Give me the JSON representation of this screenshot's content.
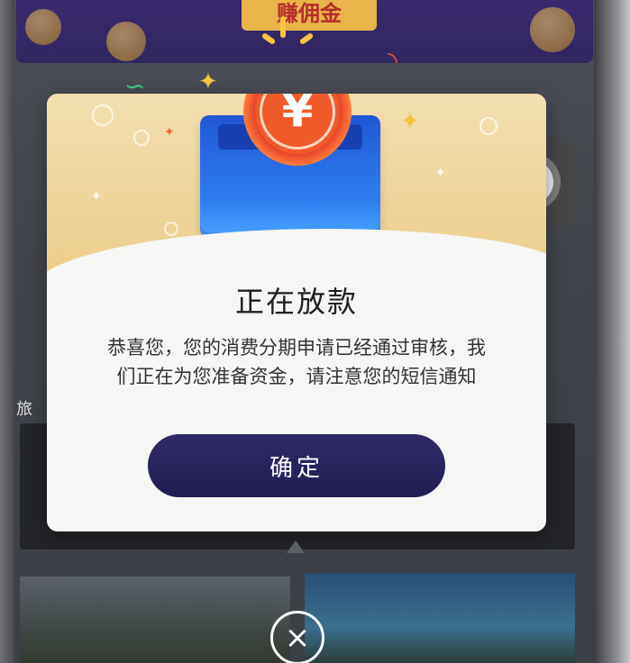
{
  "background": {
    "banner_text": "赚佣金",
    "section_label": "旅"
  },
  "dialog": {
    "coin_symbol": "¥",
    "title": "正在放款",
    "message": "恭喜您，您的消费分期申请已经通过审核，我们正在为您准备资金，请注意您的短信通知",
    "confirm_label": "确定"
  },
  "close_button": {
    "symbol": "×"
  },
  "colors": {
    "confirm_button": "#2f2a66",
    "coin": "#f05a2a",
    "wallet": "#2f7ef0",
    "hero_background": "#f3dfb0"
  }
}
